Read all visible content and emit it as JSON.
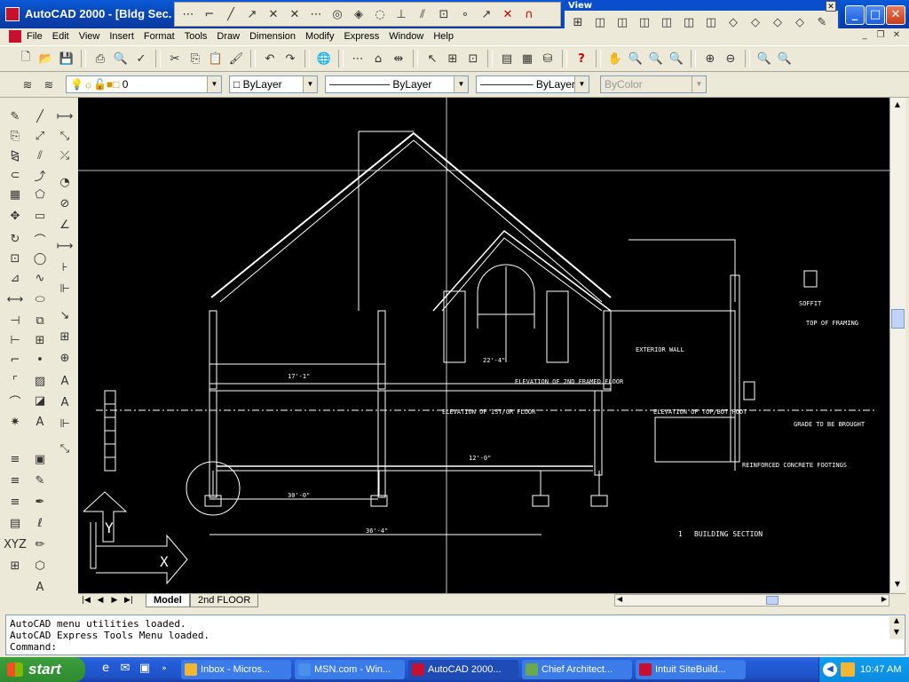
{
  "window": {
    "title": "AutoCAD 2000 - [Bldg Sec.",
    "minimize_icon": "minimize-icon",
    "maximize_icon": "maximize-icon",
    "close_icon": "close-icon"
  },
  "view_toolbar": {
    "title": "View"
  },
  "menu": {
    "items": [
      "File",
      "Edit",
      "View",
      "Insert",
      "Format",
      "Tools",
      "Draw",
      "Dimension",
      "Modify",
      "Express",
      "Window",
      "Help"
    ]
  },
  "layer_bar": {
    "layer": "0",
    "color": "ByLayer",
    "linetype": "ByLayer",
    "lineweight": "ByLayer",
    "plotstyle": "ByColor"
  },
  "drawing": {
    "labels": {
      "title": "BUILDING SECTION",
      "title_number": "1",
      "soffit": "SOFFIT",
      "elev_2nd": "ELEVATION OF 2ND FRAMED FLOOR",
      "elev_1st": "ELEVATION OF 1ST/GR FLOOR",
      "elev_top": "ELEVATION OF TOP/BOT FOOT",
      "top_of_framing": "TOP OF FRAMING",
      "dim_36": "36'-4\"",
      "dim_30": "30'-0\"",
      "dim_17": "17'-1\"",
      "dim_22": "22'-4\"",
      "dim_12": "12'-0\"",
      "exterior_wall": "EXTERIOR WALL",
      "grade": "GRADE TO BE BROUGHT",
      "reinforced": "REINFORCED CONCRETE FOOTINGS"
    }
  },
  "tabs": {
    "model": "Model",
    "floor2": "2nd FLOOR"
  },
  "command": {
    "line1": "AutoCAD menu utilities loaded.",
    "line2": "AutoCAD Express Tools Menu loaded.",
    "prompt": "Command:"
  },
  "taskbar": {
    "start": "start",
    "tasks": [
      {
        "label": "Inbox - Micros...",
        "color": "#f2b632"
      },
      {
        "label": "MSN.com - Win...",
        "color": "#4a8fe8"
      },
      {
        "label": "AutoCAD 2000...",
        "color": "#c8102e"
      },
      {
        "label": "Chief Architect...",
        "color": "#6aa84f"
      },
      {
        "label": "Intuit SiteBuild...",
        "color": "#c8102e"
      }
    ],
    "clock": "10:47 AM"
  }
}
